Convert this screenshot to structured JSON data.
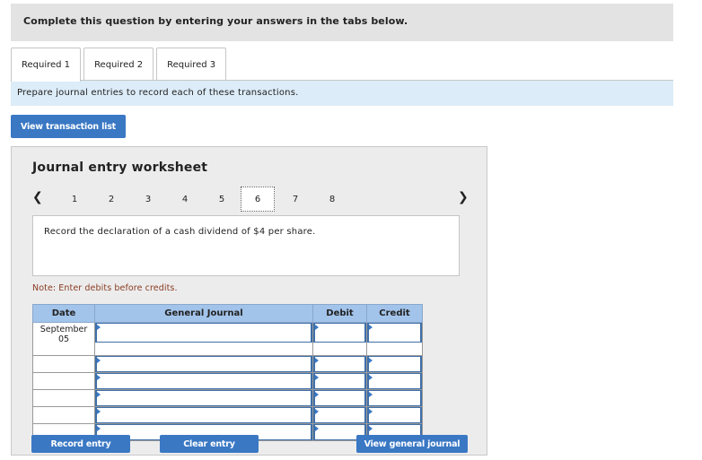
{
  "header": {
    "text": "Complete this question by entering your answers in the tabs below."
  },
  "tabs": [
    {
      "label": "Required 1",
      "active": true
    },
    {
      "label": "Required 2",
      "active": false
    },
    {
      "label": "Required 3",
      "active": false
    }
  ],
  "instruction": "Prepare journal entries to record each of these transactions.",
  "view_transaction_button": "View transaction list",
  "worksheet": {
    "title": "Journal entry worksheet",
    "prev_icon": "chevron-left-icon",
    "next_icon": "chevron-right-icon",
    "pages": [
      "1",
      "2",
      "3",
      "4",
      "5",
      "6",
      "7",
      "8"
    ],
    "active_page": "6",
    "description": "Record the declaration of a cash dividend of $4 per share.",
    "note": "Note: Enter debits before credits.",
    "table": {
      "headers": {
        "date": "Date",
        "general_journal": "General Journal",
        "debit": "Debit",
        "credit": "Credit"
      },
      "rows": [
        {
          "date": "September 05"
        },
        {
          "date": ""
        },
        {
          "date": ""
        },
        {
          "date": ""
        },
        {
          "date": ""
        },
        {
          "date": ""
        }
      ]
    }
  },
  "buttons": {
    "record_entry": "Record entry",
    "clear_entry": "Clear entry",
    "view_general_journal": "View general journal"
  },
  "colors": {
    "accent_blue": "#3a78c4",
    "header_gray": "#e3e3e3",
    "instruction_bg": "#dcecf8",
    "table_header": "#a2c3ea",
    "note_text": "#8a3b22"
  }
}
